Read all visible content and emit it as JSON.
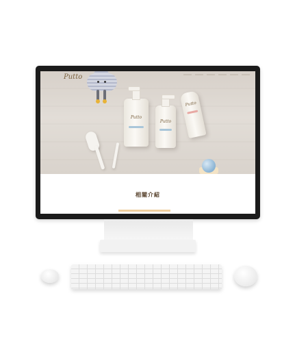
{
  "site": {
    "logo": "Putto",
    "section_title": "相關介紹"
  },
  "products": {
    "bottle_1_label": "Putto",
    "bottle_2_label": "Putto",
    "tube_label": "Putto"
  }
}
